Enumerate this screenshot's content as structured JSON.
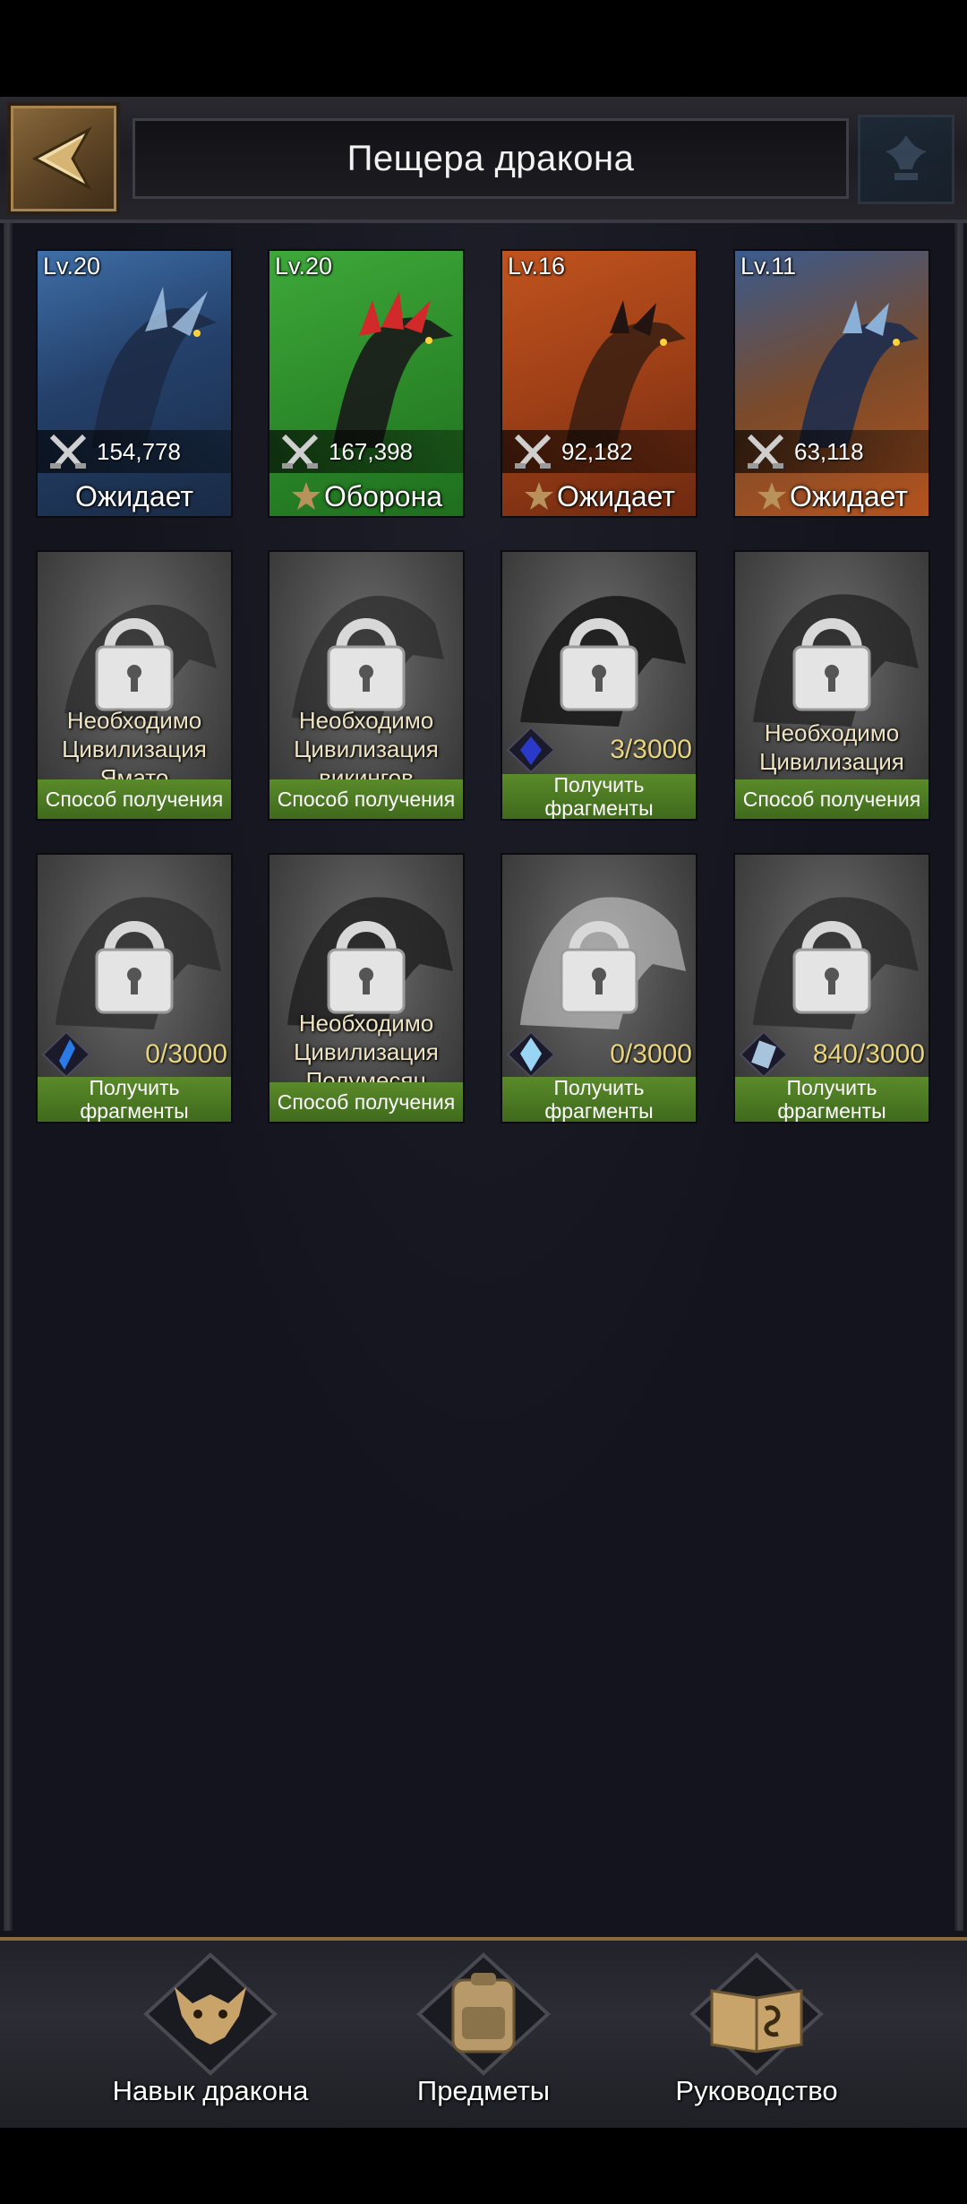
{
  "header": {
    "title": "Пещера дракона"
  },
  "owned_dragons": [
    {
      "level": "Lv.20",
      "power": "154,778",
      "status": "Ожидает",
      "starred": false,
      "bg": "blue"
    },
    {
      "level": "Lv.20",
      "power": "167,398",
      "status": "Оборона",
      "starred": true,
      "bg": "green"
    },
    {
      "level": "Lv.16",
      "power": "92,182",
      "status": "Ожидает",
      "starred": true,
      "bg": "orange"
    },
    {
      "level": "Lv.11",
      "power": "63,118",
      "status": "Ожидает",
      "starred": true,
      "bg": "orange2"
    }
  ],
  "locked_dragons": [
    {
      "requirement": "Необходимо Цивилизация Ямато",
      "action": "Способ получения"
    },
    {
      "requirement": "Необходимо Цивилизация викингов",
      "action": "Способ получения"
    },
    {
      "fragments": "3/3000",
      "action": "Получить фрагменты",
      "fragment_icon": "dark-blue-crystal-icon"
    },
    {
      "requirement": "Необходимо Цивилизация Цинь",
      "action": "Способ получения"
    },
    {
      "fragments": "0/3000",
      "action": "Получить фрагменты",
      "fragment_icon": "blue-shard-icon"
    },
    {
      "requirement": "Необходимо Цивилизация Полумесяц",
      "action": "Способ получения"
    },
    {
      "fragments": "0/3000",
      "action": "Получить фрагменты",
      "fragment_icon": "ice-crystal-icon"
    },
    {
      "fragments": "840/3000",
      "action": "Получить фрагменты",
      "fragment_icon": "frost-crystal-icon"
    }
  ],
  "bottom_nav": [
    {
      "label": "Навык дракона",
      "icon": "dragon-skull-icon"
    },
    {
      "label": "Предметы",
      "icon": "backpack-icon"
    },
    {
      "label": "Руководство",
      "icon": "guide-book-icon"
    }
  ],
  "colors": {
    "background": "#14141e",
    "action_bar": "#4a7a22",
    "fragment_count": "#e8d47c",
    "requirement_text": "#efe4c4",
    "accent_gold": "#8a6a3c"
  }
}
